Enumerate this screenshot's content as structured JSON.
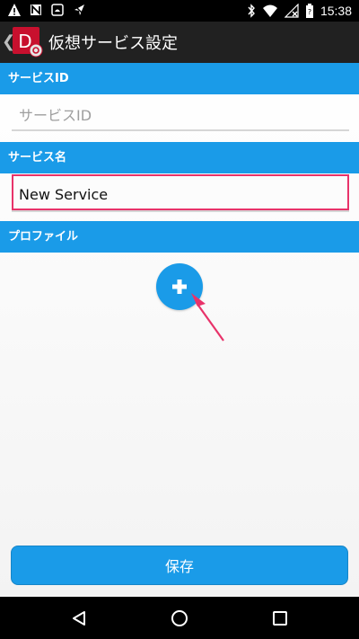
{
  "status_bar": {
    "time": "15:38",
    "left_icons": [
      "warning-icon",
      "no-sim-icon",
      "android-robot-icon",
      "no-location-icon"
    ],
    "right_icons": [
      "bluetooth-icon",
      "wifi-icon",
      "no-signal-icon",
      "battery-icon"
    ]
  },
  "app_bar": {
    "back_glyph": "❮",
    "app_icon_letter": "D",
    "title": "仮想サービス設定"
  },
  "form": {
    "service_id_header": "サービスID",
    "service_id_placeholder": "サービスID",
    "service_id_value": "",
    "service_name_header": "サービス名",
    "service_name_value": "New Service",
    "profile_header": "プロファイル",
    "add_profile_glyph": "+"
  },
  "footer": {
    "save_label": "保存"
  },
  "colors": {
    "accent": "#1a9be8",
    "highlight": "#e8336a",
    "app_bar": "#212121"
  },
  "nav_bar": {
    "buttons": [
      "back-triangle-icon",
      "home-circle-icon",
      "recents-square-icon"
    ]
  }
}
